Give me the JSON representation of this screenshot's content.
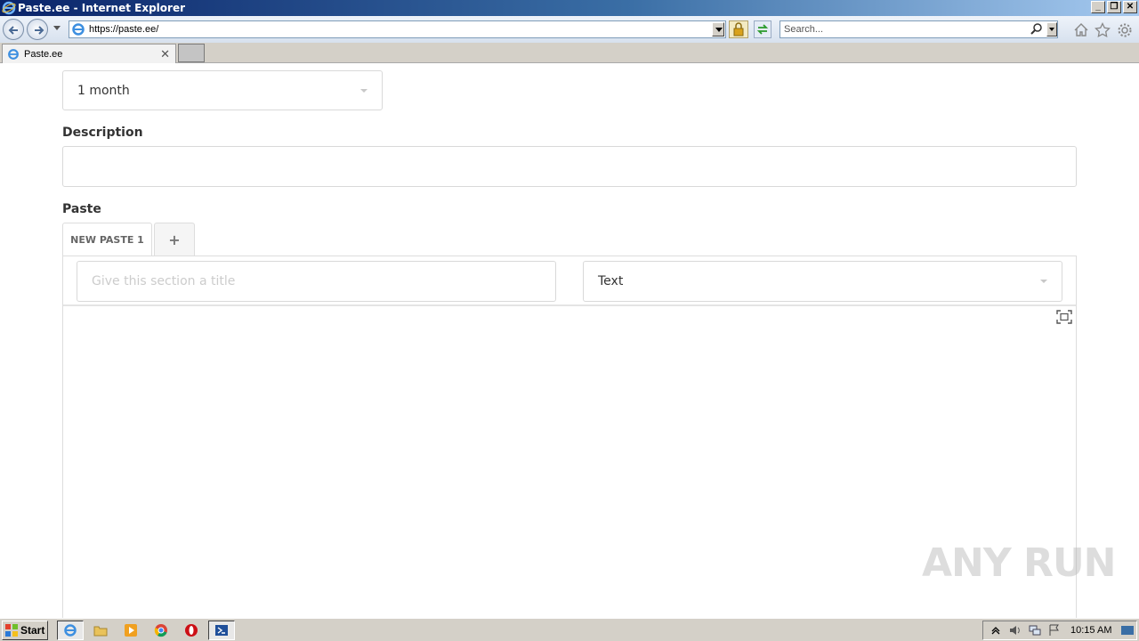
{
  "window": {
    "title": "Paste.ee - Internet Explorer",
    "buttons": [
      "_",
      "❐",
      "✕"
    ]
  },
  "browser": {
    "address": "https://paste.ee/",
    "search_placeholder": "Search..."
  },
  "tabs": [
    {
      "label": "Paste.ee",
      "close": "✕"
    }
  ],
  "form": {
    "expiration_value": "1 month",
    "description_label": "Description",
    "description_value": "",
    "paste_label": "Paste",
    "paste_tabs": [
      {
        "label": "NEW PASTE 1"
      },
      {
        "label": "+"
      }
    ],
    "section_title_placeholder": "Give this section a title",
    "syntax_value": "Text"
  },
  "watermark": "ANY RUN",
  "taskbar": {
    "start_label": "Start",
    "clock": "10:15 AM"
  }
}
